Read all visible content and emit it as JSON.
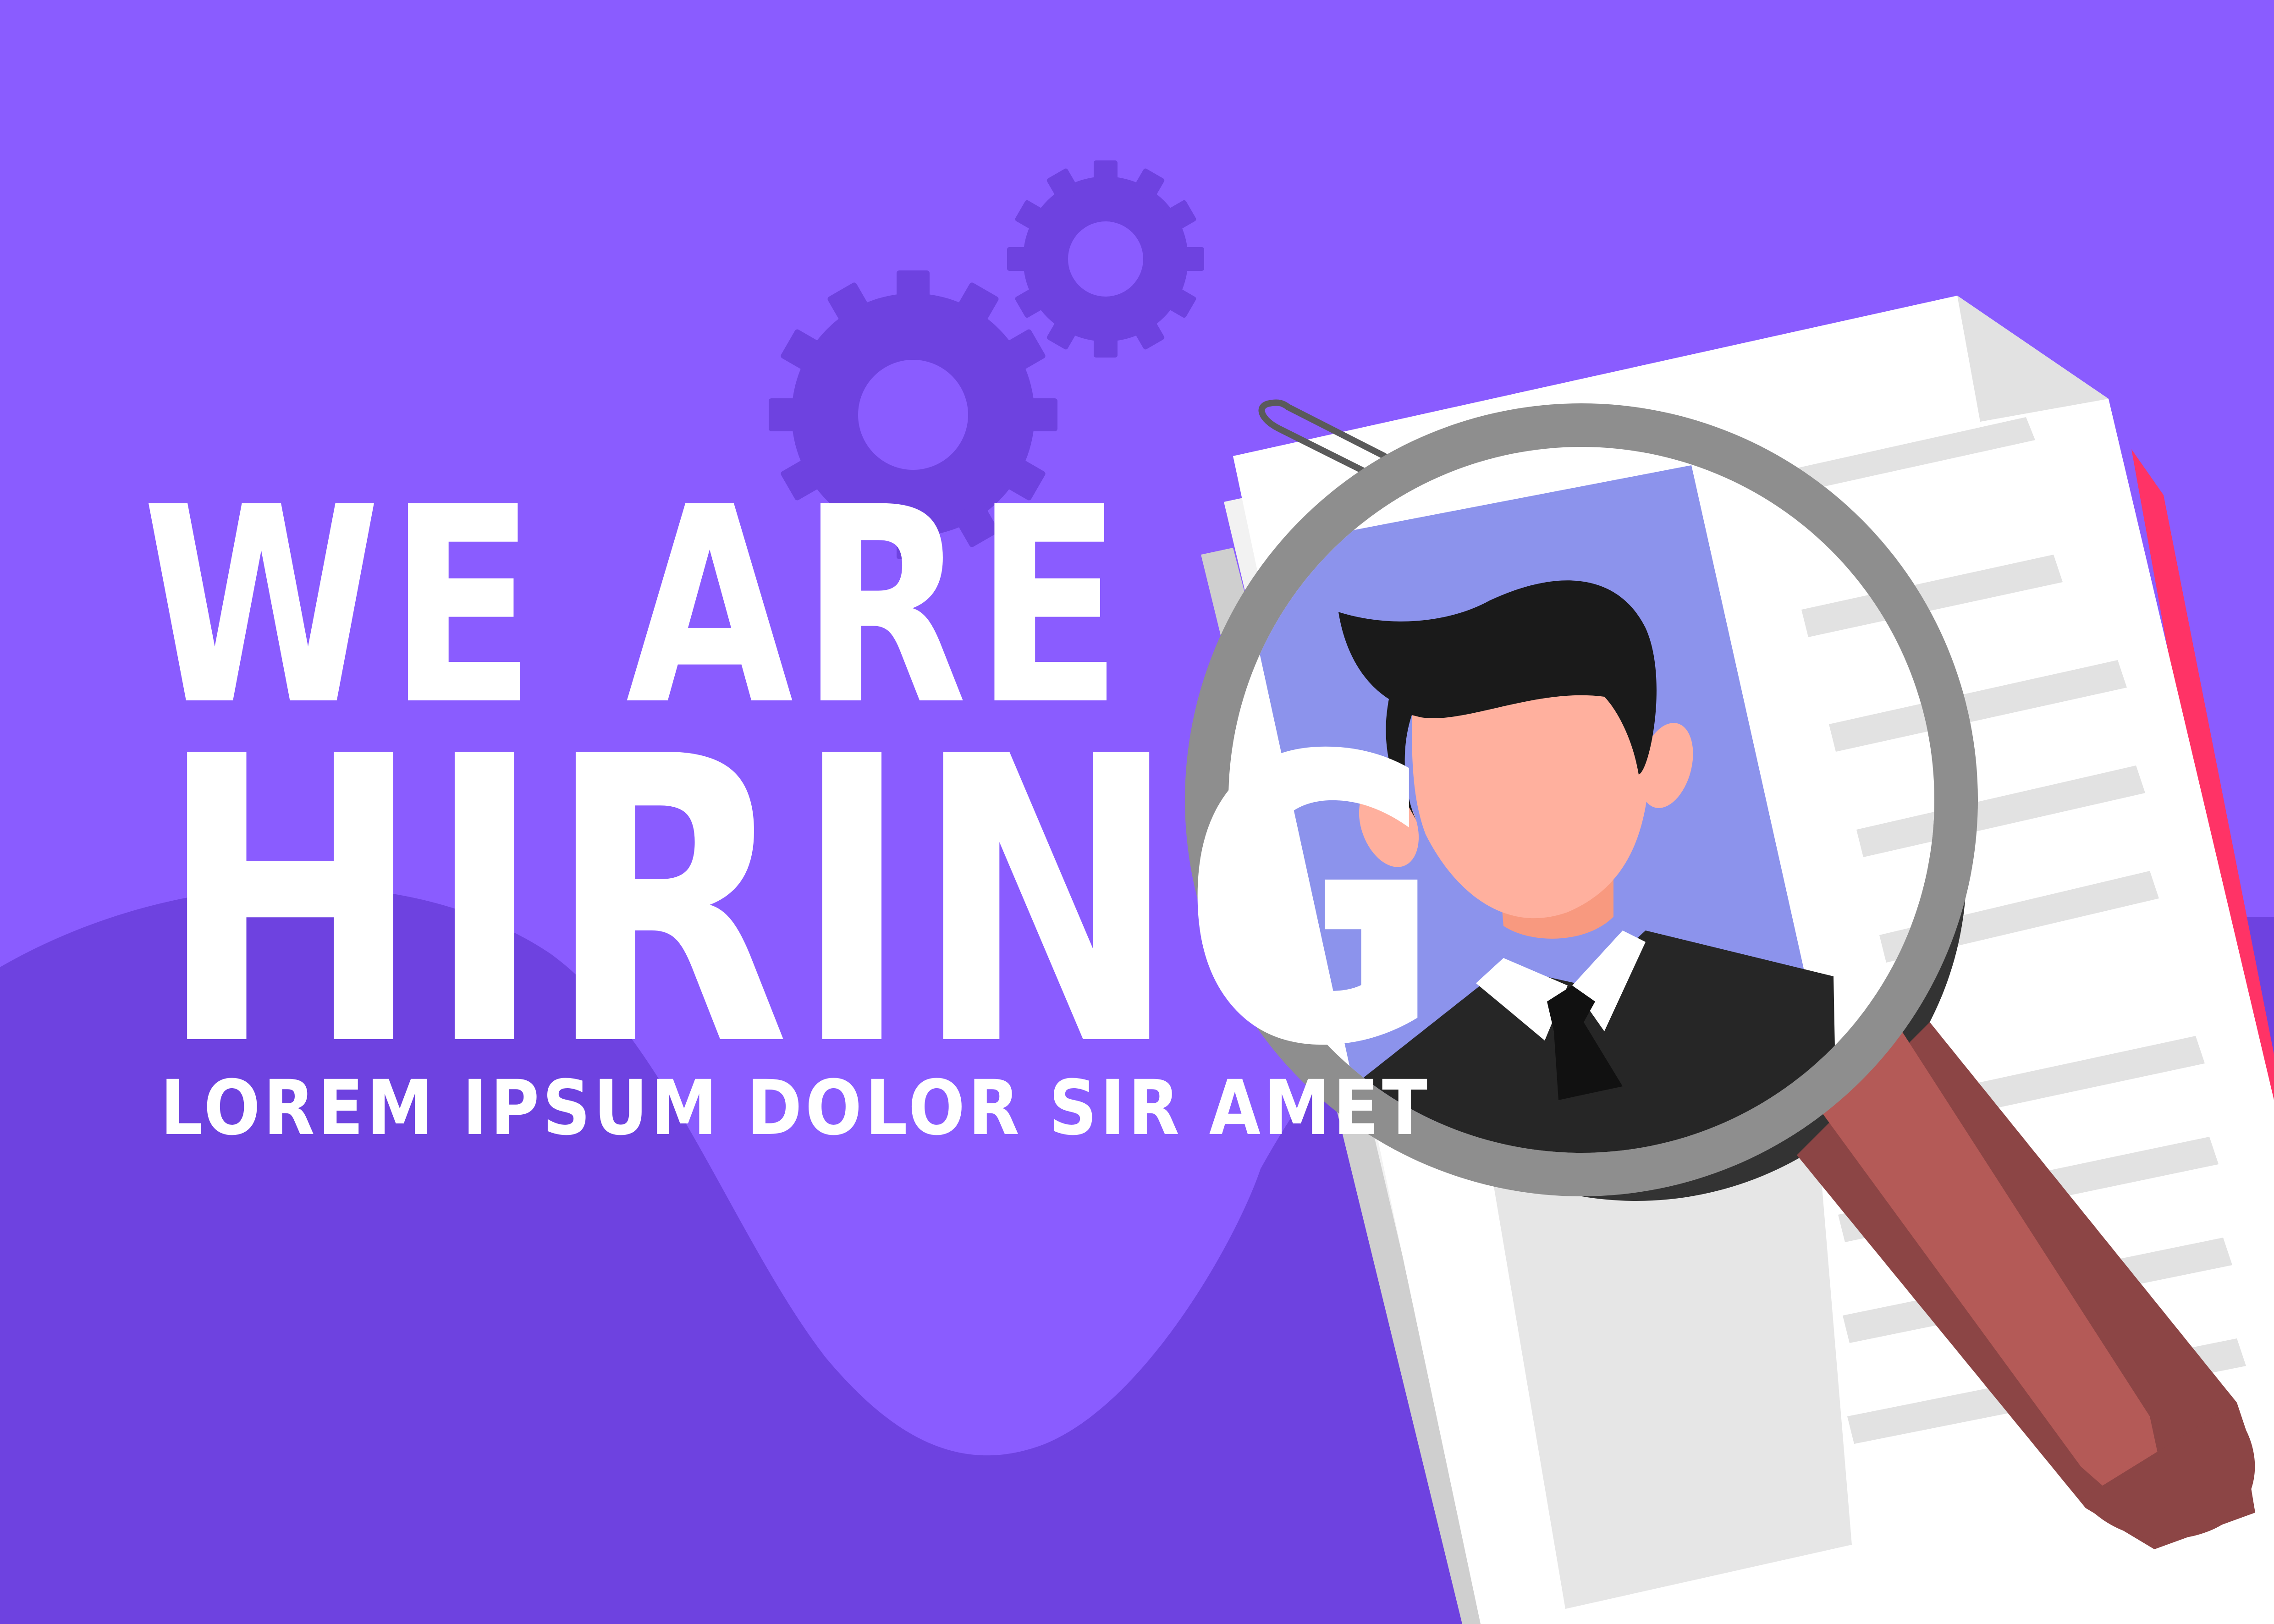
{
  "headline": {
    "line1": "WE ARE",
    "line2": "HIRING",
    "tagline": "LOREM IPSUM DOLOR SIR AMET"
  },
  "colors": {
    "background": "#8A5CFF",
    "wave": "#6E42E0",
    "gear": "#6E42E0",
    "text": "#FFFFFF",
    "photo_bg": "#8C93EC",
    "skin": "#FFB09E",
    "hair": "#1A1A1A",
    "suit": "#262626",
    "document": "#FFFFFF",
    "doc_lines": "#E2E2E2",
    "magnifier_rim": "#8E8E8E",
    "handle": "#8C4545",
    "accent_red": "#FF3366"
  },
  "icons": [
    "gear-icon",
    "gear-icon",
    "document-icon",
    "magnifying-glass-icon",
    "person-icon",
    "paper-clip-icon"
  ]
}
